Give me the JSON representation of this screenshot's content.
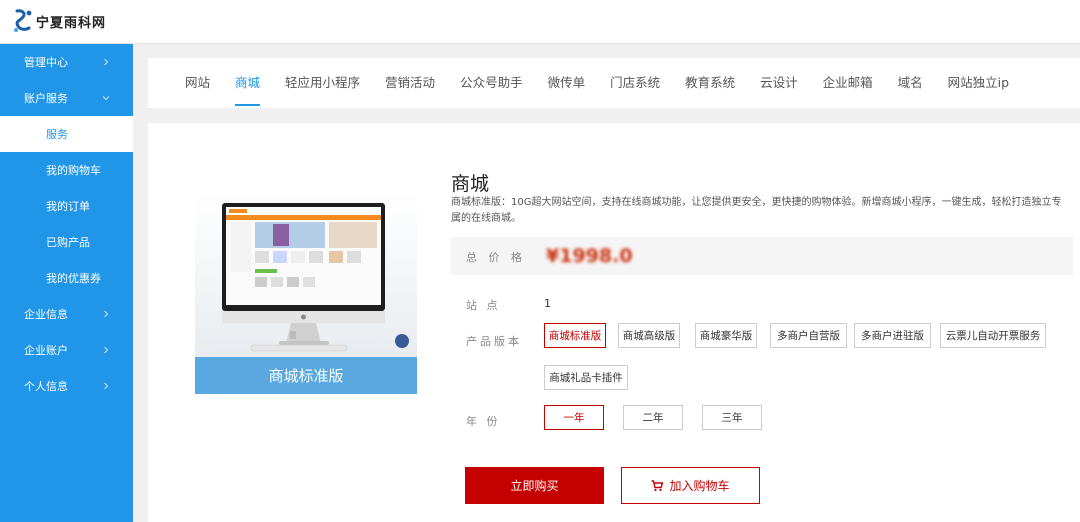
{
  "brand": {
    "name": "宁夏雨科网"
  },
  "sidebar": {
    "items": [
      {
        "label": "管理中心",
        "arrow": "right"
      },
      {
        "label": "账户服务",
        "arrow": "down"
      },
      {
        "label": "服务",
        "sub": true,
        "active": true
      },
      {
        "label": "我的购物车",
        "sub": true
      },
      {
        "label": "我的订单",
        "sub": true
      },
      {
        "label": "已购产品",
        "sub": true
      },
      {
        "label": "我的优惠券",
        "sub": true
      },
      {
        "label": "企业信息",
        "arrow": "right"
      },
      {
        "label": "企业账户",
        "arrow": "right"
      },
      {
        "label": "个人信息",
        "arrow": "right"
      }
    ]
  },
  "tabs": [
    "网站",
    "商城",
    "轻应用小程序",
    "营销活动",
    "公众号助手",
    "微传单",
    "门店系统",
    "教育系统",
    "云设计",
    "企业邮箱",
    "域名",
    "网站独立ip"
  ],
  "active_tab": "商城",
  "product": {
    "image_caption": "商城标准版",
    "title": "商城",
    "description": "商城标准版：10G超大网站空间，支持在线商城功能，让您提供更安全，更快捷的购物体验。新增商城小程序，一键生成，轻松打造独立专属的在线商城。",
    "price_label": "总 价 格",
    "price": "¥1998.0",
    "sites_label": "站    点",
    "sites_value": "1",
    "version_label": "产品版本",
    "versions": [
      "商城标准版",
      "商城高级版",
      "商城豪华版",
      "多商户自营版",
      "多商户进驻版",
      "云票儿自动开票服务",
      "商城礼品卡插件"
    ],
    "selected_version": "商城标准版",
    "year_label": "年    份",
    "years": [
      "一年",
      "二年",
      "三年"
    ],
    "selected_year": "一年",
    "buy_label": "立即购买",
    "cart_label": "加入购物车"
  },
  "colors": {
    "sidebar": "#2196e8",
    "accent": "#2196e8",
    "primary_red": "#c40000"
  },
  "icons": {
    "cart": "cart-icon",
    "arrow": "chevron-icon",
    "logo": "logo-icon"
  }
}
